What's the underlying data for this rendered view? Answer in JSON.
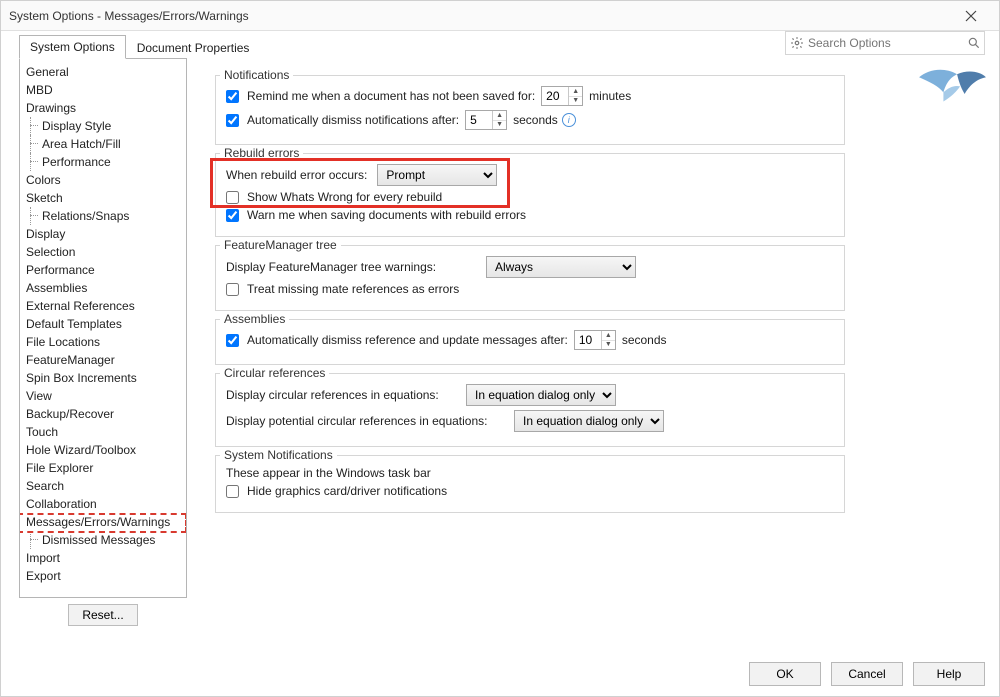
{
  "window": {
    "title": "System Options - Messages/Errors/Warnings"
  },
  "tabs": {
    "system": "System Options",
    "document": "Document Properties"
  },
  "search": {
    "placeholder": "Search Options"
  },
  "sidebar": {
    "items": [
      {
        "label": "General"
      },
      {
        "label": "MBD"
      },
      {
        "label": "Drawings"
      },
      {
        "label": "Display Style",
        "sub": true
      },
      {
        "label": "Area Hatch/Fill",
        "sub": true
      },
      {
        "label": "Performance",
        "sub": true
      },
      {
        "label": "Colors"
      },
      {
        "label": "Sketch"
      },
      {
        "label": "Relations/Snaps",
        "sub": true
      },
      {
        "label": "Display"
      },
      {
        "label": "Selection"
      },
      {
        "label": "Performance"
      },
      {
        "label": "Assemblies"
      },
      {
        "label": "External References"
      },
      {
        "label": "Default Templates"
      },
      {
        "label": "File Locations"
      },
      {
        "label": "FeatureManager"
      },
      {
        "label": "Spin Box Increments"
      },
      {
        "label": "View"
      },
      {
        "label": "Backup/Recover"
      },
      {
        "label": "Touch"
      },
      {
        "label": "Hole Wizard/Toolbox"
      },
      {
        "label": "File Explorer"
      },
      {
        "label": "Search"
      },
      {
        "label": "Collaboration"
      },
      {
        "label": "Messages/Errors/Warnings",
        "highlighted": true
      },
      {
        "label": "Dismissed Messages",
        "sub": true
      },
      {
        "label": "Import"
      },
      {
        "label": "Export"
      }
    ],
    "reset": "Reset..."
  },
  "groups": {
    "notifications": {
      "legend": "Notifications",
      "remind_label": "Remind me when a document has not been saved for:",
      "remind_value": "20",
      "remind_unit": "minutes",
      "dismiss_label": "Automatically dismiss notifications after:",
      "dismiss_value": "5",
      "dismiss_unit": "seconds"
    },
    "rebuild": {
      "legend": "Rebuild errors",
      "when_label": "When rebuild error occurs:",
      "when_value": "Prompt",
      "show_whats_wrong": "Show Whats Wrong for every rebuild",
      "warn_save": "Warn me when saving documents with rebuild errors"
    },
    "fm": {
      "legend": "FeatureManager tree",
      "display_label": "Display FeatureManager tree warnings:",
      "display_value": "Always",
      "missing_mate": "Treat missing mate references as errors"
    },
    "assemblies": {
      "legend": "Assemblies",
      "auto_label": "Automatically dismiss reference and update messages after:",
      "auto_value": "10",
      "auto_unit": "seconds"
    },
    "circular": {
      "legend": "Circular references",
      "disp1_label": "Display circular references in equations:",
      "disp1_value": "In equation dialog only",
      "disp2_label": "Display potential circular references in equations:",
      "disp2_value": "In equation dialog only"
    },
    "sysnotif": {
      "legend": "System Notifications",
      "taskbar": "These appear in the Windows task bar",
      "hide_gfx": "Hide graphics card/driver notifications"
    }
  },
  "footer": {
    "ok": "OK",
    "cancel": "Cancel",
    "help": "Help"
  }
}
